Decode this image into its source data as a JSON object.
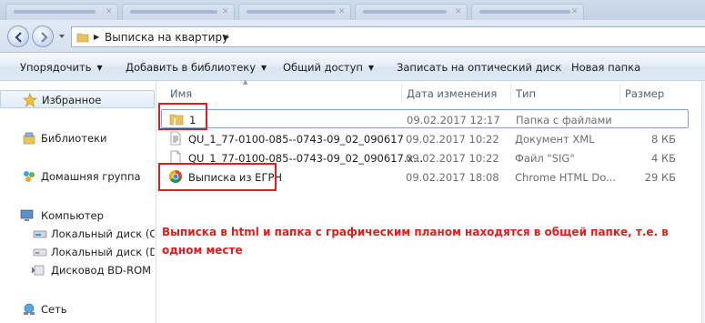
{
  "window": {
    "address": {
      "crumb": "Выписка на квартиру"
    }
  },
  "toolbar": {
    "organize": "Упорядочить",
    "add_to_library": "Добавить в библиотеку",
    "share": "Общий доступ",
    "burn": "Записать на оптический диск",
    "new_folder": "Новая папка"
  },
  "navpane": {
    "favorites": "Избранное",
    "libraries": "Библиотеки",
    "homegroup": "Домашняя группа",
    "computer": "Компьютер",
    "drive_c": "Локальный диск (C:",
    "drive_d": "Локальный диск (D:",
    "drive_bd": "Дисковод BD-ROM (",
    "network": "Сеть"
  },
  "columns": {
    "name": "Имя",
    "date": "Дата изменения",
    "type": "Тип",
    "size": "Размер"
  },
  "files": [
    {
      "name": "1",
      "date": "09.02.2017 12:17",
      "type": "Папка с файлами",
      "size": "",
      "icon": "folder-icon"
    },
    {
      "name": "QU_1_77-0100-085--0743-09_02_090617",
      "date": "09.02.2017 10:22",
      "type": "Документ XML",
      "size": "8 КБ",
      "icon": "xml-document-icon"
    },
    {
      "name": "QU_1_77-0100-085--0743-09_02_090617.x...",
      "date": "09.02.2017 10:22",
      "type": "Файл \"SIG\"",
      "size": "4 КБ",
      "icon": "file-icon"
    },
    {
      "name": "Выписка из ЕГРН",
      "date": "09.02.2017 18:08",
      "type": "Chrome HTML Do...",
      "size": "29 КБ",
      "icon": "chrome-icon"
    }
  ],
  "annotation": {
    "text": "Выписка в html и папка с графическим планом находятся в общей папке, т.е. в одном месте",
    "color": "#e01d1d"
  }
}
